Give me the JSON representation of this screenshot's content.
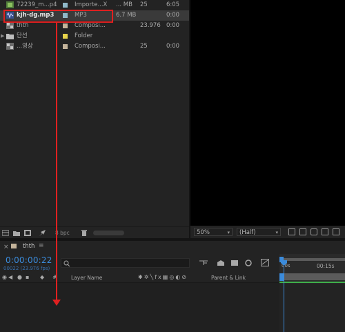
{
  "project": {
    "items": [
      {
        "name": "72239_m...p4",
        "type": "Importe...X",
        "size": "... MB",
        "fps": "25",
        "duration": "6:05",
        "swatch": "#8fb8c8",
        "icon": "video-file-icon"
      },
      {
        "name": "kjh-dg.mp3",
        "type": "MP3",
        "size": "6.7 MB",
        "fps": "",
        "duration": "0:00",
        "swatch": "#8fb8c8",
        "icon": "audio-file-icon",
        "selected": true
      },
      {
        "name": "thth",
        "type": "Composi...",
        "size": "",
        "fps": "23.976",
        "duration": "0:00",
        "swatch": "#c3b39a",
        "icon": "composition-icon"
      },
      {
        "name": "단선",
        "type": "Folder",
        "size": "",
        "fps": "",
        "duration": "",
        "swatch": "#e6d34a",
        "icon": "folder-icon"
      },
      {
        "name": "...영상",
        "type": "Composi...",
        "size": "",
        "fps": "25",
        "duration": "0:00",
        "swatch": "#c3b39a",
        "icon": "composition-icon"
      }
    ],
    "bpc_label": "8 bpc"
  },
  "viewer": {
    "zoom": "50%",
    "resolution": "(Half)"
  },
  "timeline": {
    "comp_name": "thth",
    "timecode": "0:00:00:22",
    "frame_info": "00022 (23.976 fps)",
    "search_placeholder": "",
    "columns": {
      "layer_name": "Layer Name",
      "parent": "Parent & Link"
    },
    "ruler": {
      "start": "00s",
      "mark": "00:15s"
    }
  },
  "annotation": {
    "color": "#e02020",
    "highlight_label": "kjh-dg.mp3"
  }
}
